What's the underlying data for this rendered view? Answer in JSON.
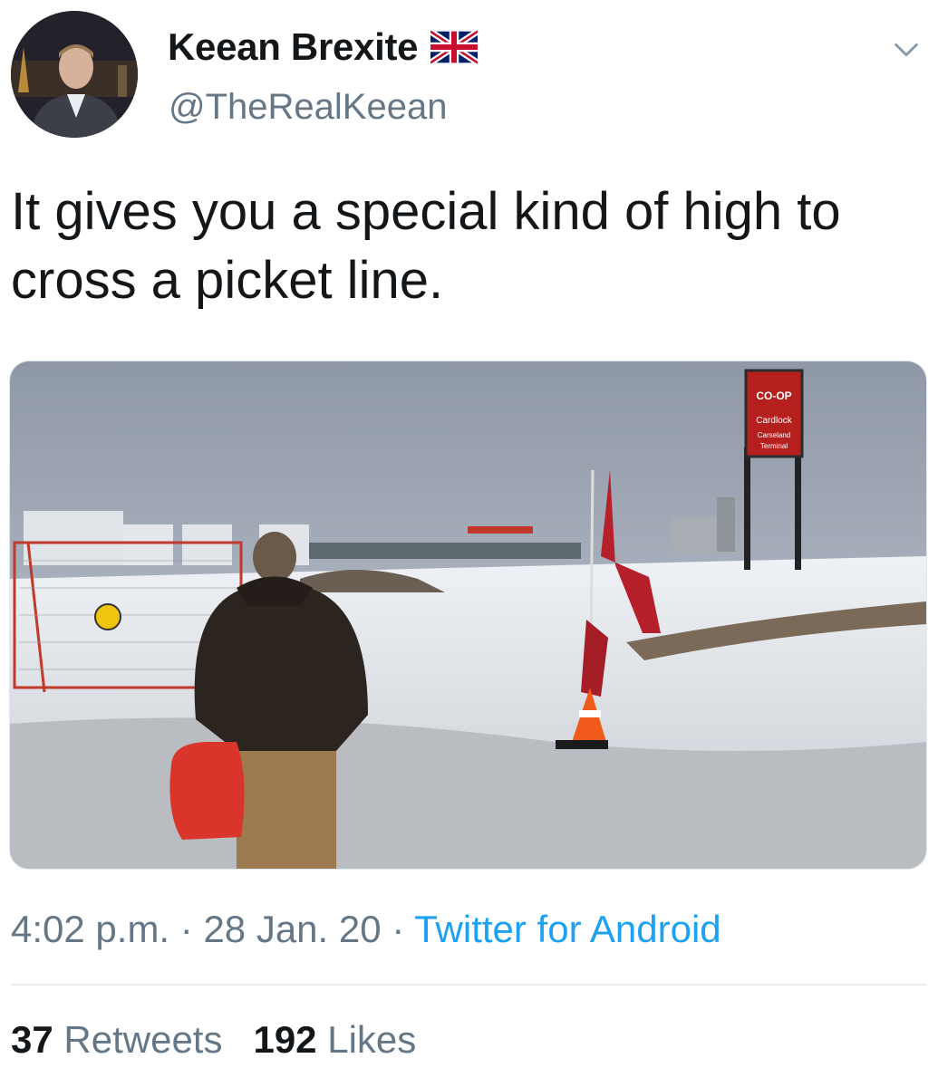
{
  "author": {
    "display_name": "Keean Brexite",
    "handle": "@TheRealKeean",
    "avatar_icon": "profile-photo",
    "badge_icon": "uk-flag-emoji"
  },
  "tweet": {
    "text": "It gives you a special kind of high to cross a picket line."
  },
  "media": {
    "sign_brand": "CO-OP",
    "sign_line1": "Cardlock",
    "sign_line2": "Carseland",
    "sign_line3": "Terminal"
  },
  "meta": {
    "time": "4:02 p.m.",
    "separator": " · ",
    "date": "28 Jan. 20",
    "source": "Twitter for Android"
  },
  "stats": {
    "retweets_count": "37",
    "retweets_label": "Retweets",
    "likes_count": "192",
    "likes_label": "Likes"
  },
  "colors": {
    "link": "#1da1f2",
    "secondary_text": "#657786",
    "primary_text": "#14171a"
  }
}
